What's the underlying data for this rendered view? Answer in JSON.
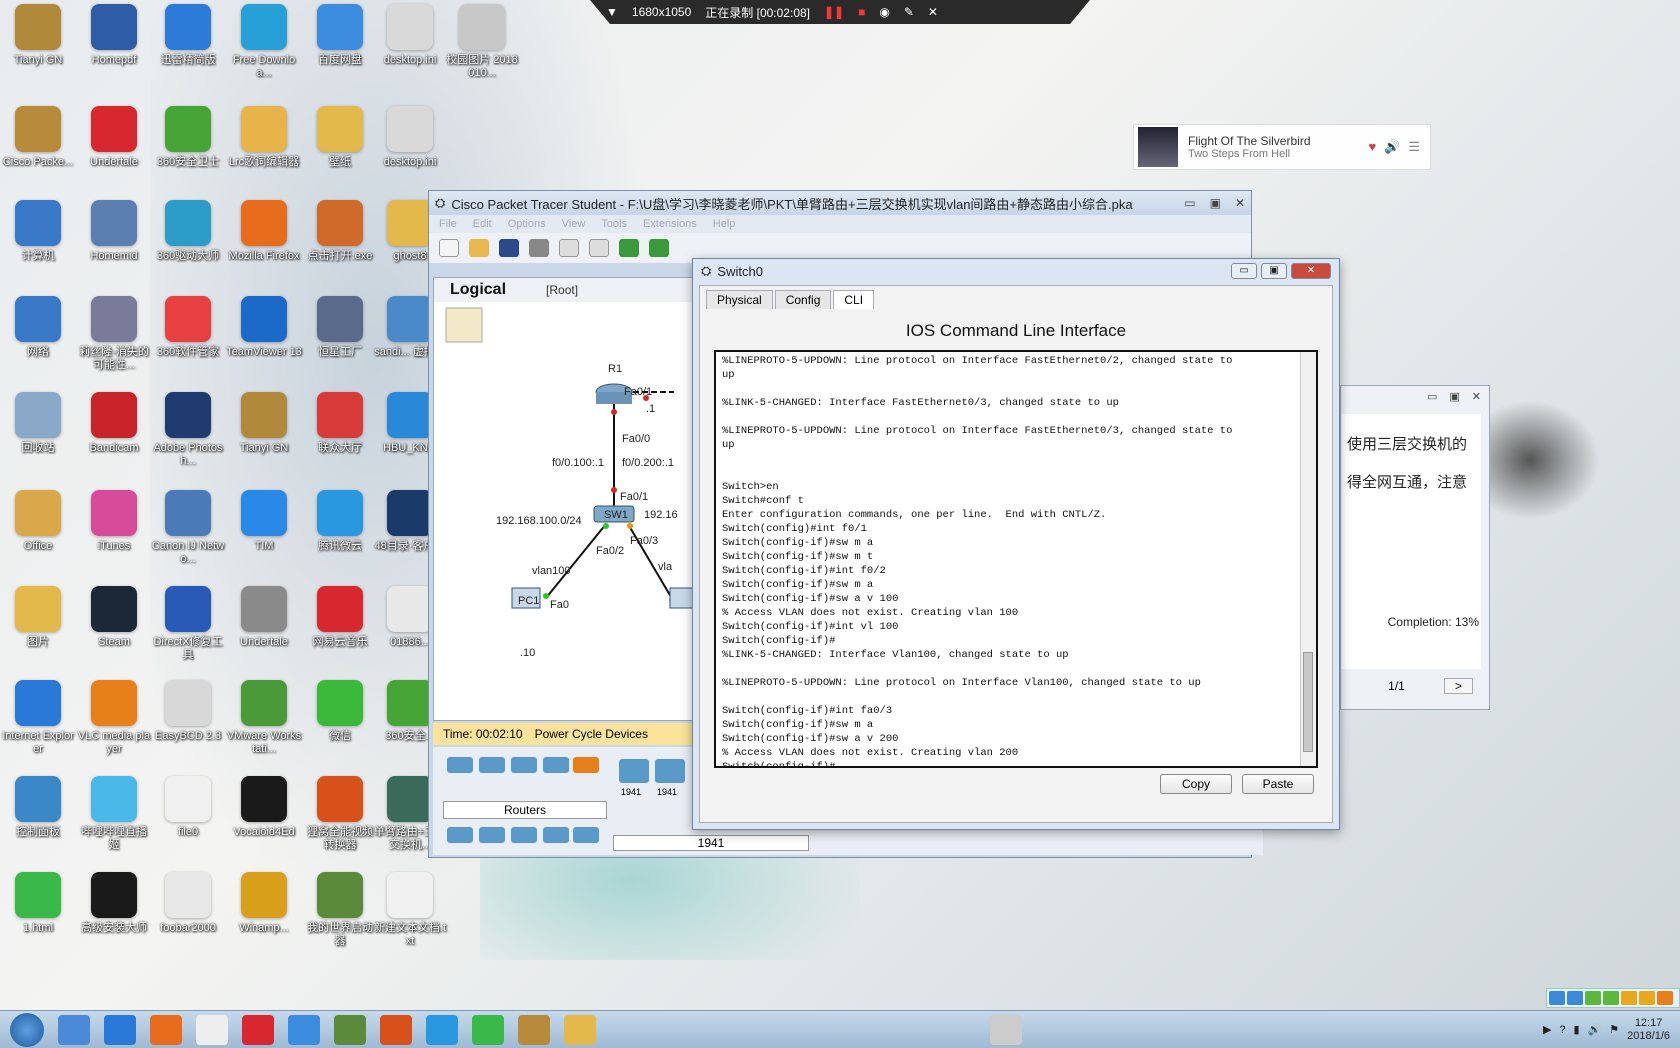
{
  "recording_bar": {
    "resolution": "1680x1050",
    "status": "正在录制 [00:02:08]"
  },
  "desktop_icons": [
    {
      "label": "Tianyi GN",
      "color": "#b08a3a"
    },
    {
      "label": "Homepdf",
      "color": "#2f5ca6"
    },
    {
      "label": "迅雷精简版",
      "color": "#2c7bd8"
    },
    {
      "label": "Free Downloa...",
      "color": "#27a0d8"
    },
    {
      "label": "百度网盘",
      "color": "#3c8ce0"
    },
    {
      "label": "desktop.ini",
      "color": "#d9d9d9"
    },
    {
      "label": "校园图片 2018010...",
      "color": "#c8c8c8"
    },
    {
      "label": "Cisco Packe...",
      "color": "#b88a3c"
    },
    {
      "label": "Undertale",
      "color": "#d8272e"
    },
    {
      "label": "360安全卫士",
      "color": "#46a536"
    },
    {
      "label": "Lrc歌词编辑器",
      "color": "#e8b44a"
    },
    {
      "label": "壁纸",
      "color": "#e2b94a"
    },
    {
      "label": "desktop.ini",
      "color": "#d9d9d9"
    },
    {
      "label": "计算机",
      "color": "#3a78c8"
    },
    {
      "label": "Homemid",
      "color": "#5a7fb0"
    },
    {
      "label": "360驱动大师",
      "color": "#2c9cc8"
    },
    {
      "label": "Mozilla Firefox",
      "color": "#e96b1c"
    },
    {
      "label": "点击打开.exe",
      "color": "#d06a2a"
    },
    {
      "label": "ghost8",
      "color": "#e2b94a"
    },
    {
      "label": "网络",
      "color": "#3a78c8"
    },
    {
      "label": "莉丝隆-消失的可能性...",
      "color": "#7a7a9a"
    },
    {
      "label": "360软件管家",
      "color": "#e84040"
    },
    {
      "label": "TeamViewer 13",
      "color": "#1b6ac9"
    },
    {
      "label": "恒星工厂",
      "color": "#5a6a8a"
    },
    {
      "label": "sandi... 虚拟机",
      "color": "#4a8ac8"
    },
    {
      "label": "回收站",
      "color": "#8aa8c8"
    },
    {
      "label": "Bandicam",
      "color": "#c8242a"
    },
    {
      "label": "Adobe Photosh...",
      "color": "#1f3b70"
    },
    {
      "label": "Tianyi GN",
      "color": "#b08a3a"
    },
    {
      "label": "联众大厅",
      "color": "#d83a3a"
    },
    {
      "label": "HBU_KN...",
      "color": "#2a88d8"
    },
    {
      "label": "Office",
      "color": "#d8a84a"
    },
    {
      "label": "iTunes",
      "color": "#d84a9a"
    },
    {
      "label": "Canon IJ Netwo...",
      "color": "#4a7ab8"
    },
    {
      "label": "TIM",
      "color": "#2a88e8"
    },
    {
      "label": "腾讯微云",
      "color": "#2a98e0"
    },
    {
      "label": "48目录·客户端",
      "color": "#1a3a6a"
    },
    {
      "label": "图片",
      "color": "#e2b94a"
    },
    {
      "label": "Steam",
      "color": "#1b2838"
    },
    {
      "label": "DirectX修复工具",
      "color": "#2a5ab8"
    },
    {
      "label": "Undertale",
      "color": "#8a8a8a"
    },
    {
      "label": "网易云音乐",
      "color": "#d8272e"
    },
    {
      "label": "01886...",
      "color": "#e8e8e8"
    },
    {
      "label": "Internet Explorer",
      "color": "#2a78d8"
    },
    {
      "label": "VLC media player",
      "color": "#e8801a"
    },
    {
      "label": "EasyBCD 2.3",
      "color": "#d8d8d8"
    },
    {
      "label": "VMware Workstati...",
      "color": "#4a9a3a"
    },
    {
      "label": "微信",
      "color": "#3ab83a"
    },
    {
      "label": "360安全...",
      "color": "#46a536"
    },
    {
      "label": "控制面板",
      "color": "#3a88c8"
    },
    {
      "label": "哔哩哔哩直播姬",
      "color": "#4ab8e8"
    },
    {
      "label": "file0",
      "color": "#f0f0f0"
    },
    {
      "label": "Vocaloid4Ed",
      "color": "#1a1a1a"
    },
    {
      "label": "狸窝全能视频转换器",
      "color": "#d8501a"
    },
    {
      "label": "单臂路由+三层交换机...",
      "color": "#3a6a5a"
    },
    {
      "label": "1.html",
      "color": "#3ab84a"
    },
    {
      "label": "高级安装大师",
      "color": "#1a1a1a"
    },
    {
      "label": "foobar2000",
      "color": "#e8e8e8"
    },
    {
      "label": "Winamp...",
      "color": "#d8a01a"
    },
    {
      "label": "我的世界启动器",
      "color": "#5a8a3a"
    },
    {
      "label": "新建文本文档.txt",
      "color": "#f0f0f0"
    }
  ],
  "music_widget": {
    "title": "Flight Of The Silverbird",
    "artist": "Two Steps From Hell"
  },
  "background_dialog": {
    "line1": "使用三层交换机的",
    "line2": "得全网互通，注意",
    "completion": "Completion: 13%",
    "page": "1/1",
    "next": ">"
  },
  "packet_tracer": {
    "title": "Cisco Packet Tracer Student - F:\\U盘\\学习\\李晓菱老师\\PKT\\单臂路由+三层交换机实现vlan间路由+静态路由小综合.pka",
    "menu": [
      "File",
      "Edit",
      "Options",
      "View",
      "Tools",
      "Extensions",
      "Help"
    ],
    "view_label": "Logical",
    "root_label": "[Root]",
    "time": "Time: 00:02:10",
    "power_cycle": "Power Cycle Devices",
    "device_category": "Routers",
    "device_model": "1941",
    "device_models_shown": [
      "1941",
      "1941"
    ],
    "topology": {
      "r1": "R1",
      "r1_fa01": "Fa0/1",
      "r1_ip": ".1",
      "r1_fa00": "Fa0/0",
      "sub100": "f0/0.100:.1",
      "sub200": "f0/0.200:.1",
      "sw_fa01": "Fa0/1",
      "net": "192.168.100.0/24",
      "net2": "192.16",
      "sw1": "SW1",
      "sw_fa02": "Fa0/2",
      "sw_fa03": "Fa0/3",
      "vlan100": "vlan100",
      "vlan_cut": "vla",
      "pc1": "PC1",
      "pc_fa0": "Fa0",
      "pc_ip": ".10"
    }
  },
  "switch_dialog": {
    "title": "Switch0",
    "tabs": [
      "Physical",
      "Config",
      "CLI"
    ],
    "active_tab": "CLI",
    "heading": "IOS Command Line Interface",
    "console_text": "%LINEPROTO-5-UPDOWN: Line protocol on Interface FastEthernet0/2, changed state to\nup\n\n%LINK-5-CHANGED: Interface FastEthernet0/3, changed state to up\n\n%LINEPROTO-5-UPDOWN: Line protocol on Interface FastEthernet0/3, changed state to\nup\n\n\nSwitch>en\nSwitch#conf t\nEnter configuration commands, one per line.  End with CNTL/Z.\nSwitch(config)#int f0/1\nSwitch(config-if)#sw m a\nSwitch(config-if)#sw m t\nSwitch(config-if)#int f0/2\nSwitch(config-if)#sw m a\nSwitch(config-if)#sw a v 100\n% Access VLAN does not exist. Creating vlan 100\nSwitch(config-if)#int vl 100\nSwitch(config-if)#\n%LINK-5-CHANGED: Interface Vlan100, changed state to up\n\n%LINEPROTO-5-UPDOWN: Line protocol on Interface Vlan100, changed state to up\n\nSwitch(config-if)#int fa0/3\nSwitch(config-if)#sw m a\nSwitch(config-if)#sw a v 200\n% Access VLAN does not exist. Creating vlan 200\nSwitch(config-if)#",
    "copy": "Copy",
    "paste": "Paste"
  },
  "taskbar": {
    "clock_time": "12:17",
    "clock_date": "2018/1/6"
  }
}
